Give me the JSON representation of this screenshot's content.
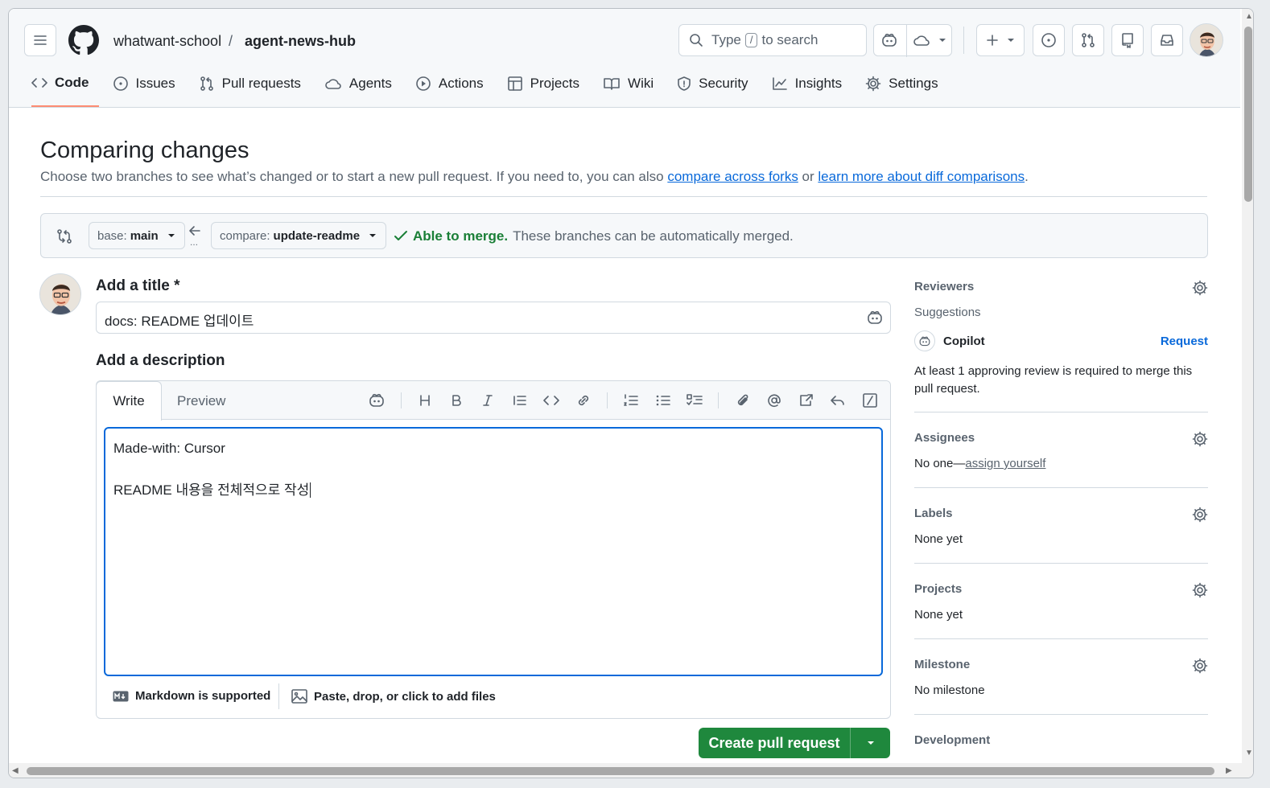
{
  "header": {
    "owner": "whatwant-school",
    "separator": "/",
    "repo": "agent-news-hub",
    "search_prefix": "Type",
    "search_key": "/",
    "search_suffix": "to search"
  },
  "tabs": [
    {
      "label": "Code",
      "icon": "code-icon"
    },
    {
      "label": "Issues",
      "icon": "issue-icon"
    },
    {
      "label": "Pull requests",
      "icon": "pull-request-icon"
    },
    {
      "label": "Agents",
      "icon": "agent-icon"
    },
    {
      "label": "Actions",
      "icon": "play-icon"
    },
    {
      "label": "Projects",
      "icon": "table-icon"
    },
    {
      "label": "Wiki",
      "icon": "book-icon"
    },
    {
      "label": "Security",
      "icon": "shield-icon"
    },
    {
      "label": "Insights",
      "icon": "graph-icon"
    },
    {
      "label": "Settings",
      "icon": "gear-icon"
    }
  ],
  "page": {
    "title": "Comparing changes",
    "subtitle_text": "Choose two branches to see what’s changed or to start a new pull request. If you need to, you can also ",
    "link_forks": "compare across forks",
    "subtitle_or": " or ",
    "link_learn": "learn more about diff comparisons",
    "subtitle_end": "."
  },
  "compare": {
    "base_label": "base:",
    "base_value": "main",
    "compare_label": "compare:",
    "compare_value": "update-readme",
    "merge_status": "Able to merge.",
    "merge_text": "These branches can be automatically merged."
  },
  "form": {
    "title_label": "Add a title",
    "required_mark": "*",
    "title_value": "docs: README 업데이트",
    "description_label": "Add a description",
    "tab_write": "Write",
    "tab_preview": "Preview",
    "description_line1": "Made-with: Cursor",
    "description_line2": "README 내용을 전체적으로 작성",
    "markdown_note": "Markdown is supported",
    "attach_note": "Paste, drop, or click to add files",
    "submit_label": "Create pull request"
  },
  "sidebar": {
    "reviewers": {
      "title": "Reviewers",
      "suggestions": "Suggestions",
      "copilot": "Copilot",
      "request": "Request",
      "note": "At least 1 approving review is required to merge this pull request."
    },
    "assignees": {
      "title": "Assignees",
      "prefix": "No one—",
      "link": "assign yourself"
    },
    "labels": {
      "title": "Labels",
      "value": "None yet"
    },
    "projects": {
      "title": "Projects",
      "value": "None yet"
    },
    "milestone": {
      "title": "Milestone",
      "value": "No milestone"
    },
    "development": {
      "title": "Development"
    }
  },
  "colors": {
    "accent": "#0969da",
    "success": "#1a7f37",
    "button": "#1f883d",
    "active_tab": "#fd8c73"
  }
}
